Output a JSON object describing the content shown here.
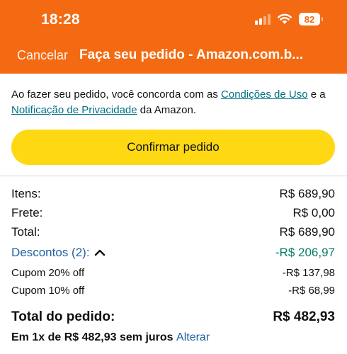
{
  "status_bar": {
    "time": "18:28",
    "battery": "82",
    "icons": [
      "cellular-signal-icon",
      "wifi-icon",
      "battery-icon"
    ]
  },
  "nav": {
    "cancel_label": "Cancelar",
    "title": "Faça seu pedido - Amazon.com.b..."
  },
  "terms": {
    "prefix": "Ao fazer seu pedido, você concorda com as ",
    "conditions_link": "Condições de Uso",
    "middle": " e a ",
    "privacy_link": "Notificação de Privacidade",
    "suffix": " da Amazon."
  },
  "confirm_button_label": "Confirmar pedido",
  "summary": {
    "items_label": "Itens:",
    "items_value": "R$ 689,90",
    "shipping_label": "Frete:",
    "shipping_value": "R$ 0,00",
    "total_label": "Total:",
    "total_value": "R$ 689,90",
    "discounts_label": "Descontos (2):",
    "discounts_value": "-R$ 206,97",
    "coupons": [
      {
        "label": "Cupom 20% off",
        "value": "-R$ 137,98"
      },
      {
        "label": "Cupom 10% off",
        "value": "-R$ 68,99"
      }
    ],
    "order_total_label": "Total do pedido:",
    "order_total_value": "R$ 482,93",
    "installment_text": "Em 1x de R$ 482,93 sem juros",
    "alter_link": "Alterar"
  },
  "colors": {
    "header": "#f46a12",
    "button": "#ffd814",
    "link": "#007185",
    "discount_value": "#067d62",
    "discount_label": "#2162a1"
  }
}
